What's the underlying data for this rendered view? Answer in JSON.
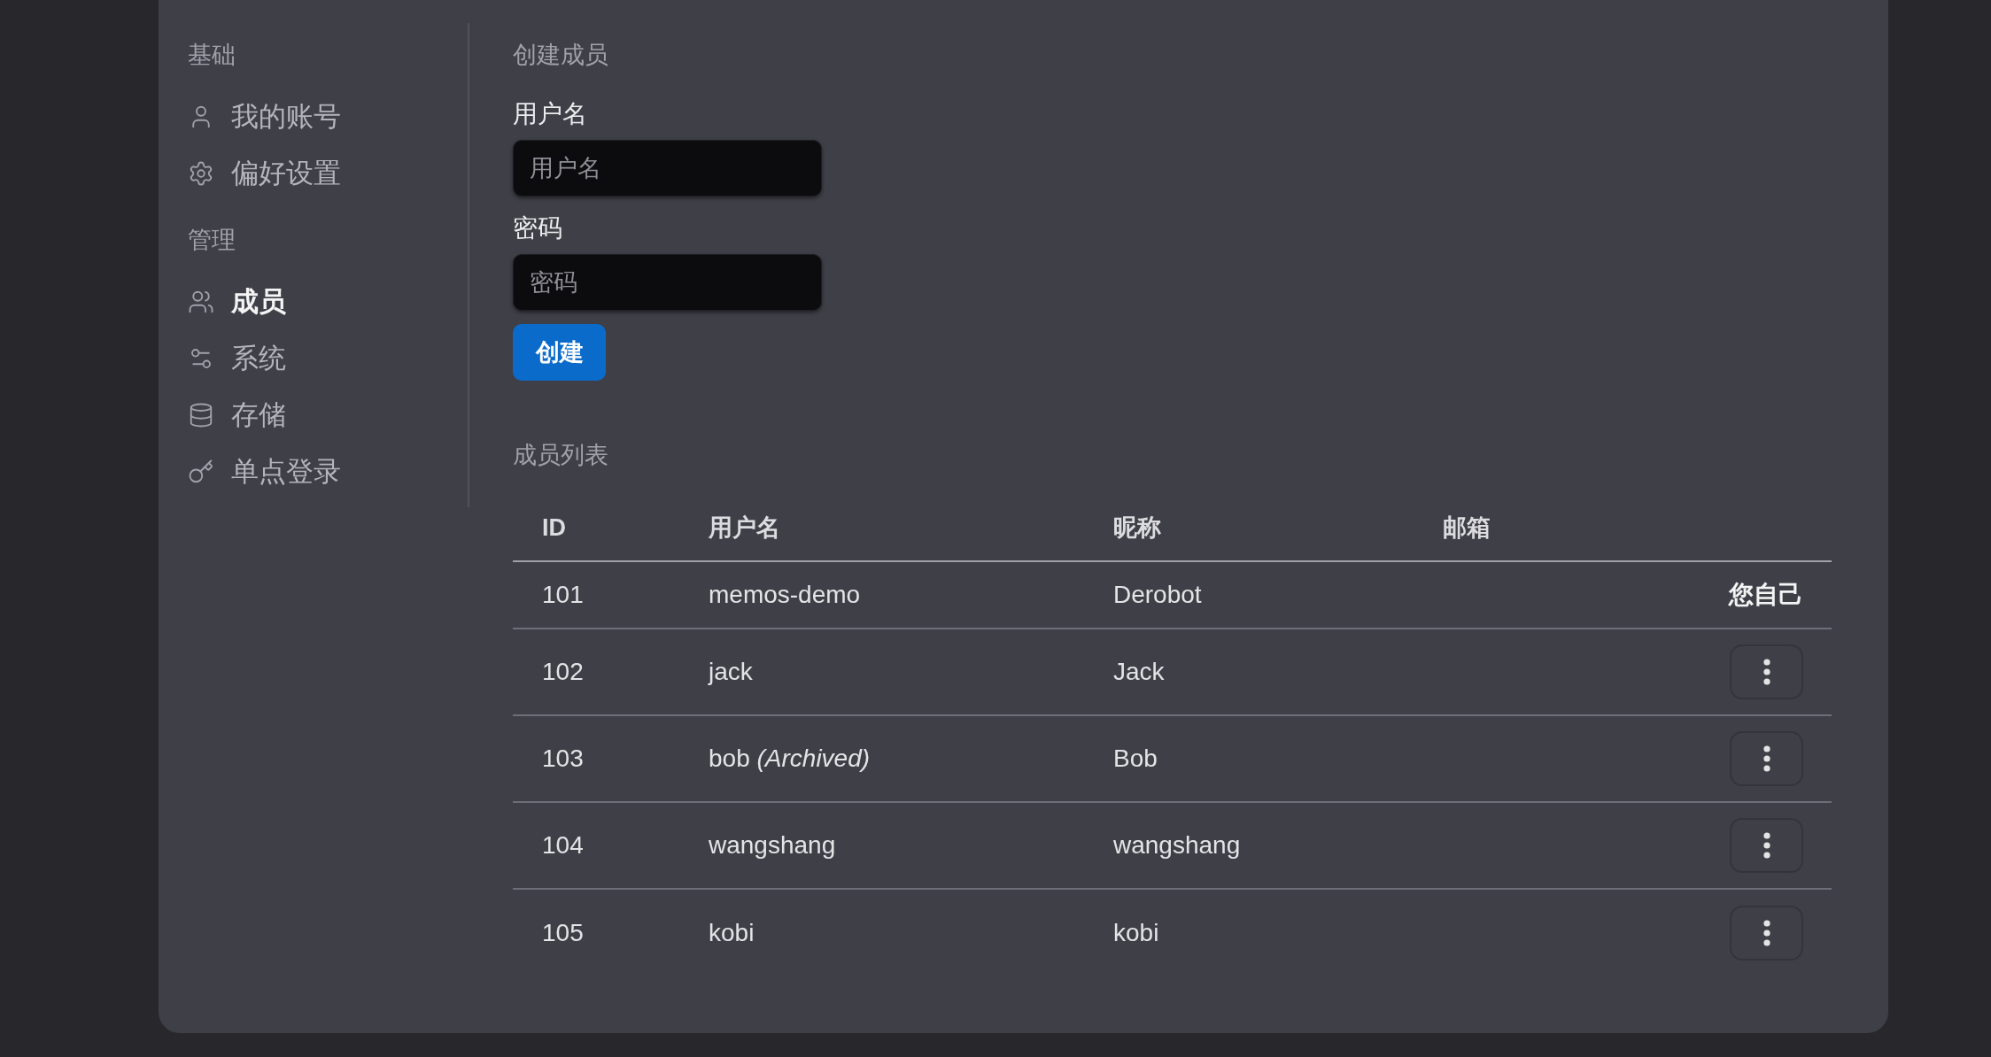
{
  "sidebar": {
    "sections": [
      {
        "heading": "基础",
        "items": [
          {
            "label": "我的账号",
            "selected": false
          },
          {
            "label": "偏好设置",
            "selected": false
          }
        ]
      },
      {
        "heading": "管理",
        "items": [
          {
            "label": "成员",
            "selected": true
          },
          {
            "label": "系统",
            "selected": false
          },
          {
            "label": "存储",
            "selected": false
          },
          {
            "label": "单点登录",
            "selected": false
          }
        ]
      }
    ]
  },
  "create_member": {
    "title": "创建成员",
    "fields": [
      {
        "label": "用户名",
        "placeholder": "用户名"
      },
      {
        "label": "密码",
        "placeholder": "密码"
      }
    ],
    "submit_button": "创建"
  },
  "member_list": {
    "title": "成员列表",
    "columns": [
      "ID",
      "用户名",
      "昵称",
      "邮箱"
    ],
    "rows": [
      {
        "kind": "self",
        "id": "101",
        "username": "memos-demo",
        "nickname": "Derobot",
        "note": "您自己"
      },
      {
        "kind": "member",
        "id": "102",
        "username": "jack",
        "nickname": "Jack"
      },
      {
        "kind": "member",
        "id": "103",
        "username": "bob *(Archived)*",
        "nickname": "Bob"
      },
      {
        "kind": "member",
        "id": "104",
        "username": "wangshang",
        "nickname": "wangshang"
      },
      {
        "kind": "member",
        "id": "105",
        "username": "kobi",
        "nickname": "kobi"
      }
    ]
  }
}
